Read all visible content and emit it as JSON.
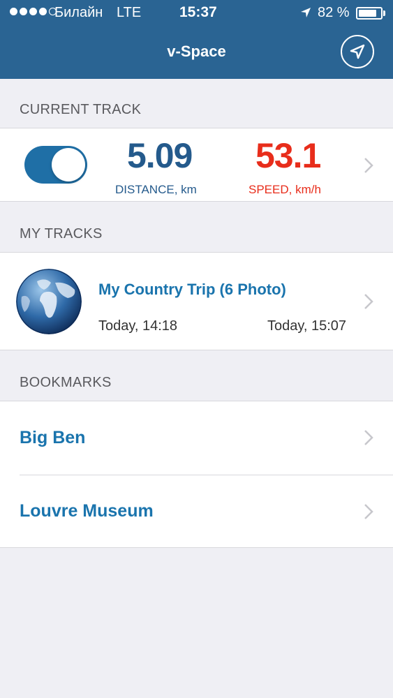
{
  "status_bar": {
    "carrier": "Билайн",
    "network": "LTE",
    "time": "15:37",
    "battery": "82 %",
    "battery_level": 0.82
  },
  "nav": {
    "title": "v-Space",
    "location_icon": "navigation-arrow-icon"
  },
  "current_track": {
    "header": "CURRENT TRACK",
    "toggle_on": true,
    "distance_value": "5.09",
    "distance_label": "DISTANCE, km",
    "speed_value": "53.1",
    "speed_label": "SPEED, km/h"
  },
  "my_tracks": {
    "header": "MY TRACKS",
    "items": [
      {
        "title": "My Country Trip (6 Photo)",
        "start": "Today, 14:18",
        "end": "Today, 15:07",
        "thumbnail_icon": "globe-icon"
      }
    ]
  },
  "bookmarks": {
    "header": "BOOKMARKS",
    "items": [
      {
        "label": "Big Ben"
      },
      {
        "label": "Louvre Museum"
      }
    ]
  },
  "colors": {
    "nav_bar": "#2a6493",
    "distance": "#245a8c",
    "speed": "#e82d1b",
    "link": "#1a74ad",
    "background": "#efeff4"
  }
}
